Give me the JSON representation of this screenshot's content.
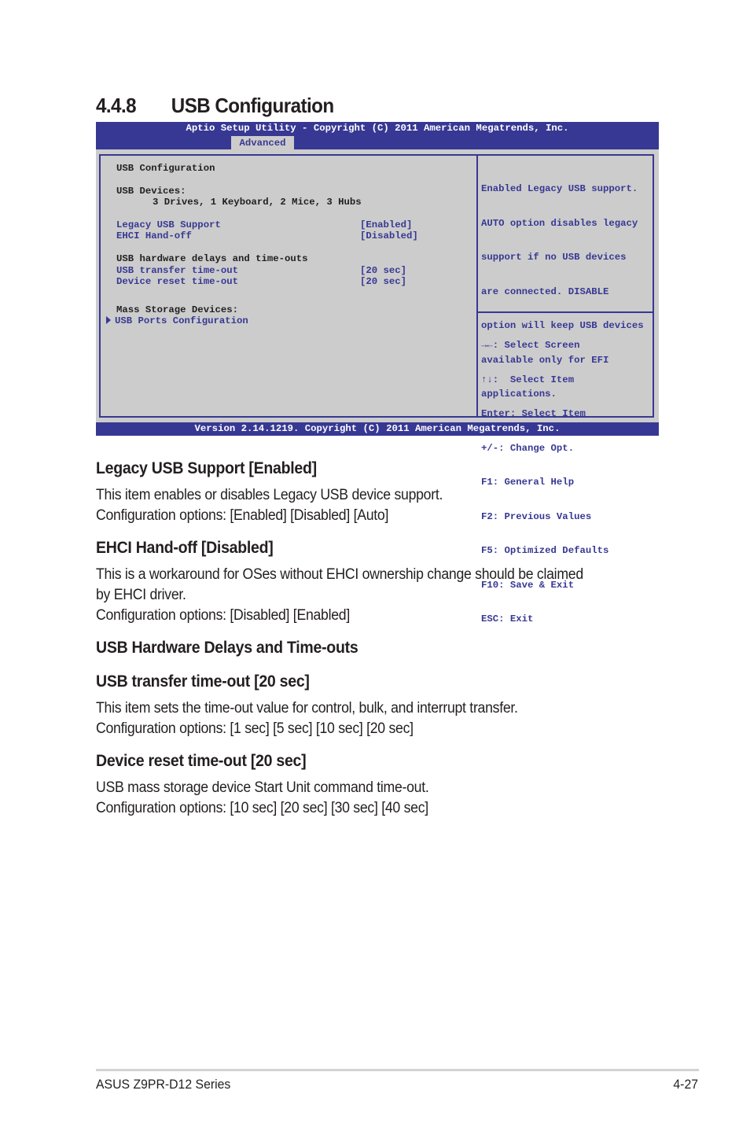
{
  "section": {
    "number": "4.4.8",
    "title": "USB Configuration"
  },
  "bios": {
    "title_bar": "Aptio Setup Utility - Copyright (C) 2011 American Megatrends, Inc.",
    "active_tab": "Advanced",
    "version_bar": "Version 2.14.1219. Copyright (C) 2011 American Megatrends, Inc.",
    "colors": {
      "bar": "#373893",
      "panel": "#cccccc",
      "item_text": "#373893"
    },
    "main": {
      "heading": "USB Configuration",
      "devices_label": "USB Devices:",
      "devices_value": "3 Drives, 1 Keyboard, 2 Mice, 3 Hubs",
      "settings_group1": [
        {
          "label": "Legacy USB Support",
          "value": "[Enabled]"
        },
        {
          "label": "EHCI Hand-off",
          "value": "[Disabled]"
        }
      ],
      "delays_heading": "USB hardware delays and time-outs",
      "settings_group2": [
        {
          "label": "USB transfer time-out",
          "value": "[20 sec]"
        },
        {
          "label": "Device reset time-out",
          "value": "[20 sec]"
        }
      ],
      "mass_storage_label": "Mass Storage Devices:",
      "submenu": "USB Ports Configuration"
    },
    "help": [
      "Enabled Legacy USB support.",
      "AUTO option disables legacy",
      "support if no USB devices",
      "are connected. DISABLE",
      "option will keep USB devices",
      "available only for EFI",
      "applications."
    ],
    "keys": [
      "→←: Select Screen",
      "↑↓:  Select Item",
      "Enter: Select Item",
      "+/-: Change Opt.",
      "F1: General Help",
      "F2: Previous Values",
      "F5: Optimized Defaults",
      "F10: Save & Exit",
      "ESC: Exit"
    ]
  },
  "items": [
    {
      "heading": "Legacy USB Support [Enabled]",
      "lines": [
        "This item enables or disables Legacy USB device support.",
        "Configuration options: [Enabled] [Disabled] [Auto]"
      ]
    },
    {
      "heading": "EHCI Hand-off [Disabled]",
      "lines": [
        "This is a workaround for OSes without EHCI ownership change should be claimed",
        "by EHCI driver.",
        "Configuration options: [Disabled] [Enabled]"
      ]
    },
    {
      "heading": "USB Hardware Delays and Time-outs",
      "lines": []
    },
    {
      "heading": "USB transfer time-out [20 sec]",
      "lines": [
        "This item sets the time-out value for control, bulk, and interrupt transfer.",
        "Configuration options: [1 sec] [5 sec] [10 sec] [20 sec]"
      ]
    },
    {
      "heading": "Device reset time-out [20 sec]",
      "lines": [
        "USB mass storage device Start Unit command time-out.",
        "Configuration options: [10 sec] [20 sec] [30 sec] [40 sec]"
      ]
    }
  ],
  "footer": {
    "product": "ASUS Z9PR-D12 Series",
    "page": "4-27"
  }
}
